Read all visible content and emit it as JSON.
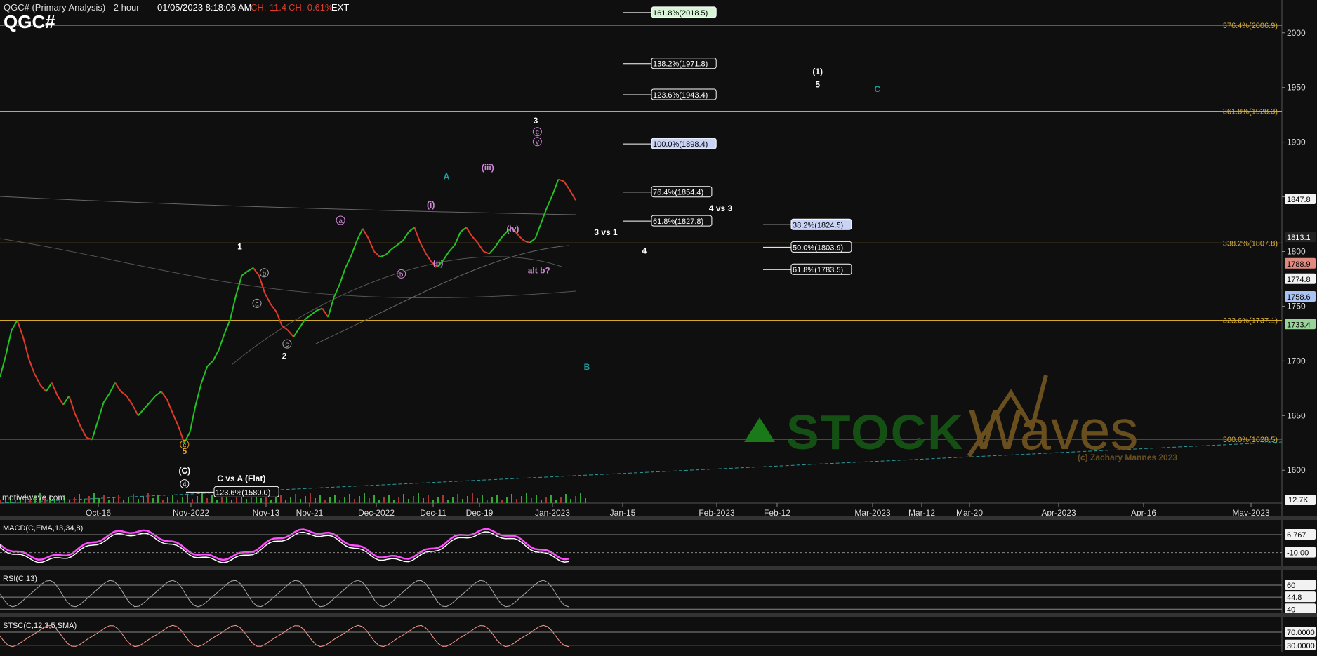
{
  "header": {
    "title": "QGC# (Primary Analysis) - 2 hour",
    "datetime": "01/05/2023 8:18:06 AM",
    "change": "CH:-11.4",
    "change_pct": "CH:-0.61%",
    "session": "EXT",
    "symbol": "QGC#"
  },
  "colors": {
    "background": "#0f0f0f",
    "price_up": "#22c322",
    "price_down": "#e03a2a",
    "fib_line": "#d2a92a",
    "fib_text": "#d9b140",
    "wave_white": "#ffffff",
    "wave_magenta": "#d08ad8",
    "wave_teal": "#1fa0a0",
    "macd_line": "#ff4dff",
    "macd_signal": "#ffffff",
    "histogram": "#5fb0d8"
  },
  "chart_data": {
    "type": "line",
    "title": "QGC# (Primary Analysis) - 2 hour",
    "ylim": [
      1570,
      2030
    ],
    "y_ticks": [
      1600,
      1650,
      1700,
      1750,
      1800,
      1850,
      1900,
      1950,
      2000
    ],
    "x_tick_labels": [
      "Oct-16",
      "Nov-2022",
      "Nov-13",
      "Nov-21",
      "Dec-2022",
      "Dec-11",
      "Dec-19",
      "Jan-2023",
      "Jan-15",
      "Feb-2023",
      "Feb-12",
      "Mar-2023",
      "Mar-12",
      "Mar-20",
      "Apr-2023",
      "Apr-16",
      "May-2023"
    ],
    "series": [
      {
        "values": [
          1685,
          1705,
          1728,
          1737,
          1722,
          1702,
          1688,
          1678,
          1672,
          1680,
          1668,
          1660,
          1668,
          1652,
          1640,
          1630,
          1628,
          1645,
          1662,
          1670,
          1680,
          1672,
          1668,
          1660,
          1650,
          1656,
          1662,
          1668,
          1672,
          1665,
          1652,
          1640,
          1625,
          1635,
          1660,
          1680,
          1695,
          1700,
          1710,
          1725,
          1738,
          1760,
          1778,
          1782,
          1785,
          1778,
          1762,
          1752,
          1745,
          1732,
          1728,
          1722,
          1730,
          1738,
          1742,
          1746,
          1748,
          1740,
          1758,
          1770,
          1785,
          1796,
          1810,
          1821,
          1812,
          1800,
          1795,
          1797,
          1802,
          1806,
          1810,
          1818,
          1822,
          1808,
          1798,
          1790,
          1786,
          1792,
          1800,
          1806,
          1818,
          1822,
          1814,
          1808,
          1800,
          1798,
          1804,
          1812,
          1818,
          1822,
          1815,
          1810,
          1808,
          1812,
          1826,
          1840,
          1852,
          1866,
          1864,
          1856,
          1847
        ]
      }
    ],
    "fib_levels": [
      {
        "label": "376.4%(2006.9)",
        "value": 2006.9
      },
      {
        "label": "361.8%(1928.3)",
        "value": 1928.3
      },
      {
        "label": "338.2%(1807.8)",
        "value": 1807.8
      },
      {
        "label": "323.6%(1737.1)",
        "value": 1737.1
      },
      {
        "label": "300.0%(1628.5)",
        "value": 1628.5
      }
    ],
    "target_boxes": [
      {
        "label": "161.8%(2018.5)",
        "value": 2018.5,
        "col": 0,
        "style": "green"
      },
      {
        "label": "138.2%(1971.8)",
        "value": 1971.8,
        "col": 0,
        "style": "plain"
      },
      {
        "label": "123.6%(1943.4)",
        "value": 1943.4,
        "col": 0,
        "style": "plain"
      },
      {
        "label": "100.0%(1898.4)",
        "value": 1898.4,
        "col": 0,
        "style": "blue"
      },
      {
        "label": "76.4%(1854.4)",
        "value": 1854.4,
        "col": 0,
        "style": "plain"
      },
      {
        "label": "61.8%(1827.8)",
        "value": 1827.8,
        "col": 0,
        "style": "plain"
      },
      {
        "label": "38.2%(1824.5)",
        "value": 1824.5,
        "col": 1,
        "style": "blue"
      },
      {
        "label": "50.0%(1803.9)",
        "value": 1803.9,
        "col": 1,
        "style": "plain"
      },
      {
        "label": "61.8%(1783.5)",
        "value": 1783.5,
        "col": 1,
        "style": "plain"
      },
      {
        "label": "123.6%(1580.0)",
        "value": 1580.0,
        "col": 2,
        "style": "plain"
      }
    ],
    "wave_labels": [
      {
        "text": "1",
        "color": "white",
        "i": 42.5,
        "v": 1802
      },
      {
        "text": "2",
        "color": "white",
        "i": 50.5,
        "v": 1702
      },
      {
        "text": "(1)",
        "color": "white",
        "i": 146.2,
        "v": 1962
      },
      {
        "text": "5",
        "color": "white",
        "i": 146.2,
        "v": 1950
      },
      {
        "text": "3",
        "color": "white",
        "i": 95.6,
        "v": 1917
      },
      {
        "text": "4",
        "color": "white",
        "i": 115.1,
        "v": 1798
      },
      {
        "text": "3 vs 1",
        "color": "white",
        "i": 108.2,
        "v": 1815
      },
      {
        "text": "4 vs 3",
        "color": "white",
        "i": 128.8,
        "v": 1837
      },
      {
        "text": "C vs A (Flat)",
        "color": "white",
        "i": 42.8,
        "v": 1590
      },
      {
        "text": "(C)",
        "color": "white",
        "i": 32.6,
        "v": 1597
      },
      {
        "text": "(iii)",
        "color": "magenta",
        "i": 87.0,
        "v": 1874
      },
      {
        "text": "(iv)",
        "color": "magenta",
        "i": 91.5,
        "v": 1818
      },
      {
        "text": "alt b?",
        "color": "magenta",
        "i": 96.2,
        "v": 1780
      },
      {
        "text": "(ii)",
        "color": "magenta",
        "i": 78.1,
        "v": 1787
      },
      {
        "text": "(i)",
        "color": "magenta",
        "i": 76.8,
        "v": 1840
      },
      {
        "text": "A",
        "color": "teal",
        "i": 79.6,
        "v": 1866
      },
      {
        "text": "B",
        "color": "teal",
        "i": 104.8,
        "v": 1692
      },
      {
        "text": "C",
        "color": "teal",
        "i": 156.9,
        "v": 1946
      },
      {
        "text": "5",
        "color": "orange",
        "i": 32.6,
        "v": 1615
      }
    ],
    "circled_labels": [
      {
        "text": "a",
        "color": "grey",
        "i": 45.6,
        "v": 1750
      },
      {
        "text": "b",
        "color": "grey",
        "i": 46.9,
        "v": 1778
      },
      {
        "text": "c",
        "color": "grey",
        "i": 51.0,
        "v": 1713
      },
      {
        "text": "a",
        "color": "magenta",
        "i": 60.6,
        "v": 1826
      },
      {
        "text": "b",
        "color": "magenta",
        "i": 71.5,
        "v": 1777
      },
      {
        "text": "c",
        "color": "magenta",
        "i": 95.9,
        "v": 1907
      },
      {
        "text": "v",
        "color": "magenta",
        "i": 95.9,
        "v": 1898
      },
      {
        "text": "4",
        "color": "white",
        "i": 32.6,
        "v": 1585
      },
      {
        "text": "c",
        "color": "orange",
        "i": 32.6,
        "v": 1621
      }
    ],
    "price_badges": [
      {
        "label": "1847.8",
        "value": 1847.8,
        "style": "white"
      },
      {
        "label": "1813.1",
        "value": 1813.1,
        "style": "dark"
      },
      {
        "label": "1788.9",
        "value": 1788.9,
        "style": "red"
      },
      {
        "label": "1774.8",
        "value": 1774.8,
        "style": "white"
      },
      {
        "label": "1758.6",
        "value": 1758.6,
        "style": "blue"
      },
      {
        "label": "1733.4",
        "value": 1733.4,
        "style": "green"
      }
    ],
    "volume_badge": "12.7K",
    "indicators": [
      {
        "name": "MACD(C,EMA,13,34,8)",
        "badges": [
          "6.767",
          "-10.00"
        ],
        "levels": [
          0
        ]
      },
      {
        "name": "RSI(C,13)",
        "badges": [
          "60",
          "44.8",
          "40"
        ],
        "levels": [
          60,
          50,
          40
        ]
      },
      {
        "name": "STSC(C,12,3,5,SMA)",
        "badges": [
          "70.0000",
          "30.0000"
        ],
        "levels": [
          70,
          30
        ]
      }
    ]
  },
  "footer": {
    "source": "motivewave.com"
  },
  "watermark": {
    "brand": "STOCK Waves",
    "credit": "(c) Zachary Mannes 2023"
  }
}
